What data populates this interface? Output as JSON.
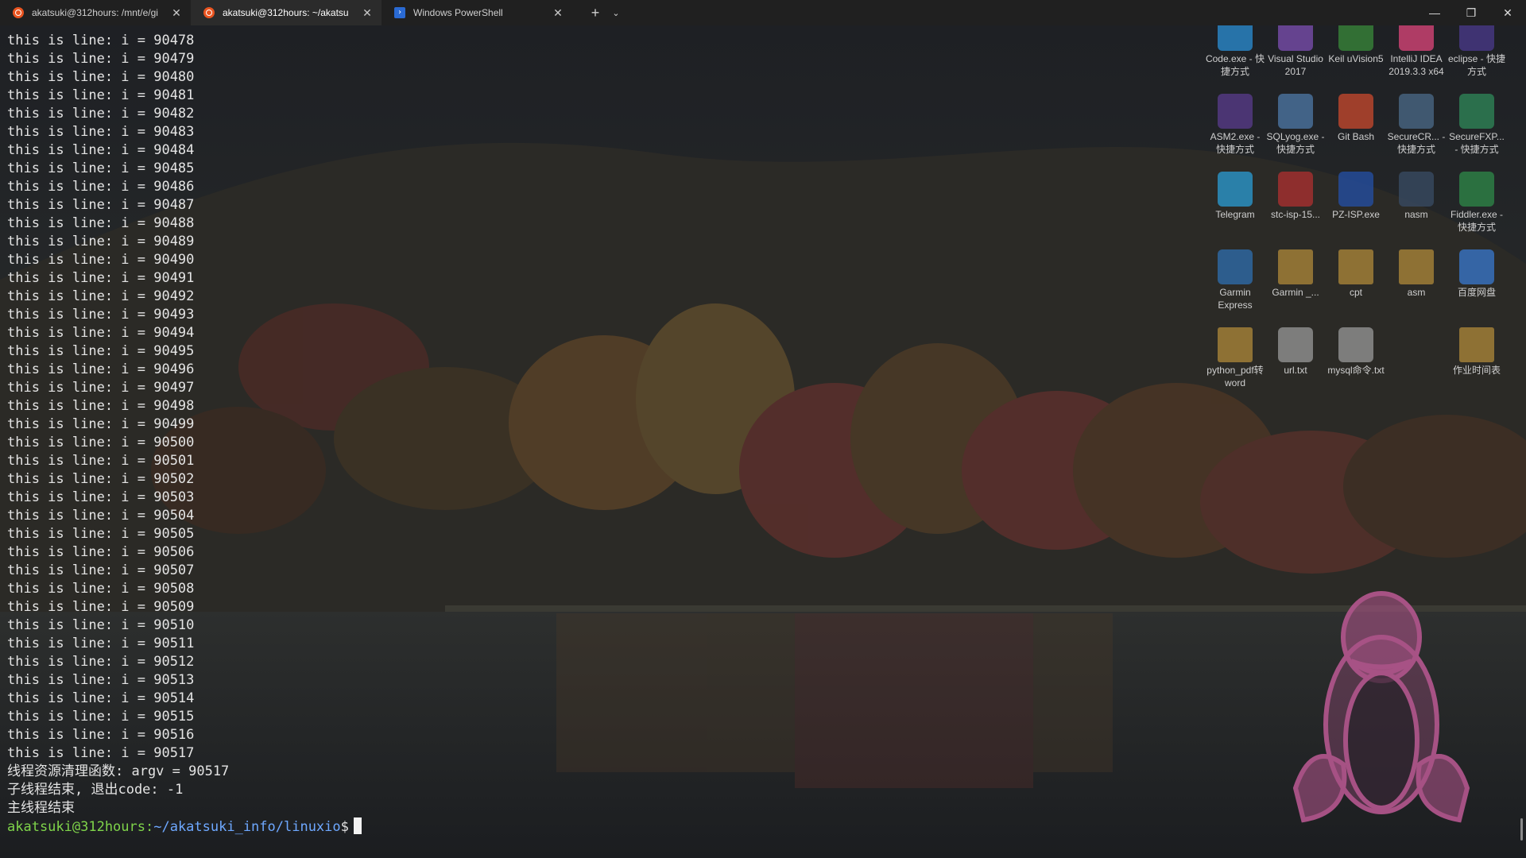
{
  "tabs": [
    {
      "label": "akatsuki@312hours: /mnt/e/gi",
      "icon": "ubuntu-icon",
      "active": false
    },
    {
      "label": "akatsuki@312hours: ~/akatsu",
      "icon": "ubuntu-icon",
      "active": true
    },
    {
      "label": "Windows PowerShell",
      "icon": "powershell-icon",
      "active": false
    }
  ],
  "titlebar": {
    "new_tab": "+",
    "dropdown": "⌄",
    "minimize": "—",
    "restore": "❐",
    "close": "✕"
  },
  "terminal": {
    "lines": [
      "this is line: i = 90478",
      "this is line: i = 90479",
      "this is line: i = 90480",
      "this is line: i = 90481",
      "this is line: i = 90482",
      "this is line: i = 90483",
      "this is line: i = 90484",
      "this is line: i = 90485",
      "this is line: i = 90486",
      "this is line: i = 90487",
      "this is line: i = 90488",
      "this is line: i = 90489",
      "this is line: i = 90490",
      "this is line: i = 90491",
      "this is line: i = 90492",
      "this is line: i = 90493",
      "this is line: i = 90494",
      "this is line: i = 90495",
      "this is line: i = 90496",
      "this is line: i = 90497",
      "this is line: i = 90498",
      "this is line: i = 90499",
      "this is line: i = 90500",
      "this is line: i = 90501",
      "this is line: i = 90502",
      "this is line: i = 90503",
      "this is line: i = 90504",
      "this is line: i = 90505",
      "this is line: i = 90506",
      "this is line: i = 90507",
      "this is line: i = 90508",
      "this is line: i = 90509",
      "this is line: i = 90510",
      "this is line: i = 90511",
      "this is line: i = 90512",
      "this is line: i = 90513",
      "this is line: i = 90514",
      "this is line: i = 90515",
      "this is line: i = 90516",
      "this is line: i = 90517",
      "线程资源清理函数: argv = 90517",
      "子线程结束, 退出code: -1",
      "主线程结束"
    ],
    "prompt_user": "akatsuki@312hours:",
    "prompt_path": "~/akatsuki_info/linuxio",
    "prompt_symbol": "$"
  },
  "desktop_icons": [
    {
      "label": "Code.exe - 快捷方式",
      "icon": "vscode-icon",
      "color": "#2b8fd6"
    },
    {
      "label": "Visual Studio 2017",
      "icon": "visual-studio-icon",
      "color": "#7d4fb3"
    },
    {
      "label": "Keil uVision5",
      "icon": "keil-icon",
      "color": "#3a8a3a"
    },
    {
      "label": "IntelliJ IDEA 2019.3.3 x64",
      "icon": "intellij-icon",
      "color": "#e0457b"
    },
    {
      "label": "eclipse - 快捷方式",
      "icon": "eclipse-icon",
      "color": "#4b3a8c"
    },
    {
      "label": "ASM2.exe - 快捷方式",
      "icon": "asm2-icon",
      "color": "#5a3c8e"
    },
    {
      "label": "SQLyog.exe - 快捷方式",
      "icon": "sqlyog-icon",
      "color": "#4d7aa8"
    },
    {
      "label": "Git Bash",
      "icon": "git-bash-icon",
      "color": "#c94a2e"
    },
    {
      "label": "SecureCR... - 快捷方式",
      "icon": "securecrt-icon",
      "color": "#4b6b8a"
    },
    {
      "label": "SecureFXP... - 快捷方式",
      "icon": "securefx-icon",
      "color": "#2f8a5a"
    },
    {
      "label": "Telegram",
      "icon": "telegram-icon",
      "color": "#2b9ed6"
    },
    {
      "label": "stc-isp-15...",
      "icon": "stc-isp-icon",
      "color": "#b03030"
    },
    {
      "label": "PZ-ISP.exe",
      "icon": "pz-isp-icon",
      "color": "#2450a8"
    },
    {
      "label": "nasm",
      "icon": "nasm-icon",
      "color": "#3a4c66"
    },
    {
      "label": "Fiddler.exe - 快捷方式",
      "icon": "fiddler-icon",
      "color": "#2f8a4a"
    },
    {
      "label": "Garmin Express",
      "icon": "garmin-icon",
      "color": "#2f6fb0"
    },
    {
      "label": "Garmin _...",
      "icon": "folder-icon",
      "color": "#b08a3a"
    },
    {
      "label": "cpt",
      "icon": "folder-icon",
      "color": "#b08a3a"
    },
    {
      "label": "asm",
      "icon": "folder-icon",
      "color": "#b08a3a"
    },
    {
      "label": "百度网盘",
      "icon": "baidu-netdisk-icon",
      "color": "#3a7ad0"
    },
    {
      "label": "python_pdf转word",
      "icon": "folder-icon",
      "color": "#b08a3a"
    },
    {
      "label": "url.txt",
      "icon": "text-file-icon",
      "color": "#9a9a9a"
    },
    {
      "label": "mysql命令.txt",
      "icon": "text-file-icon",
      "color": "#9a9a9a"
    },
    {
      "label": "作业时间表",
      "icon": "folder-icon",
      "color": "#b08a3a"
    }
  ],
  "colors": {
    "prompt_user": "#7fd44a",
    "prompt_path": "#6ea8ff",
    "tux": "#b5578f"
  }
}
